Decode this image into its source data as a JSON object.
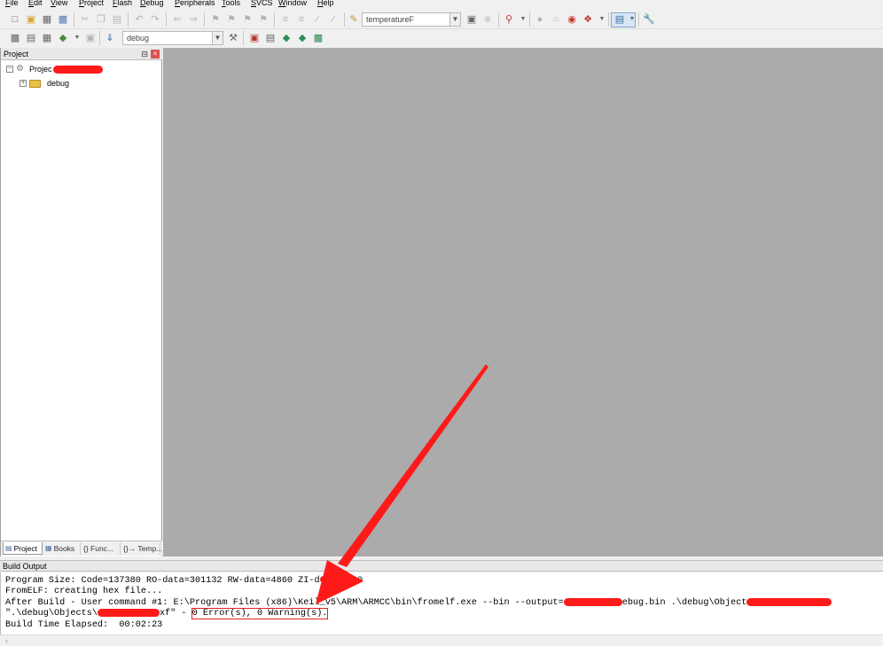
{
  "menu": [
    "File",
    "Edit",
    "View",
    "Project",
    "Flash",
    "Debug",
    "Peripherals",
    "Tools",
    "SVCS",
    "Window",
    "Help"
  ],
  "toolbar": {
    "target_combo": "temperatureF",
    "build_target": "debug"
  },
  "project_panel": {
    "title": "Project",
    "pin_glyph": "Ⲃ",
    "root_label": "Projec",
    "child_label": "debug",
    "tabs": [
      "Project",
      "Books",
      "{} Func...",
      "{}→ Temp..."
    ]
  },
  "build_output": {
    "title": "Build Output",
    "lines": {
      "l1": "Program Size: Code=137380 RO-data=301132 RW-data=4860 ZI-d",
      "l1b": "99060",
      "l2": "FromELF: creating hex file...",
      "l3a": "After Build - User command #1: E:\\Program Files (x86)\\Keil_v5\\ARM\\ARMCC\\bin\\fromelf.exe --bin --output=",
      "l3b": "ebug.bin .\\debug\\Object",
      "l4a": "\".\\debug\\Objects\\",
      "l4b": "xf\" - ",
      "l4c": "0 Error(s), 0 Warning(s).",
      "l5": "Build Time Elapsed:  00:02:23"
    }
  },
  "colors": {
    "annotation": "#ff1a1a",
    "editor_bg": "#ababab"
  }
}
